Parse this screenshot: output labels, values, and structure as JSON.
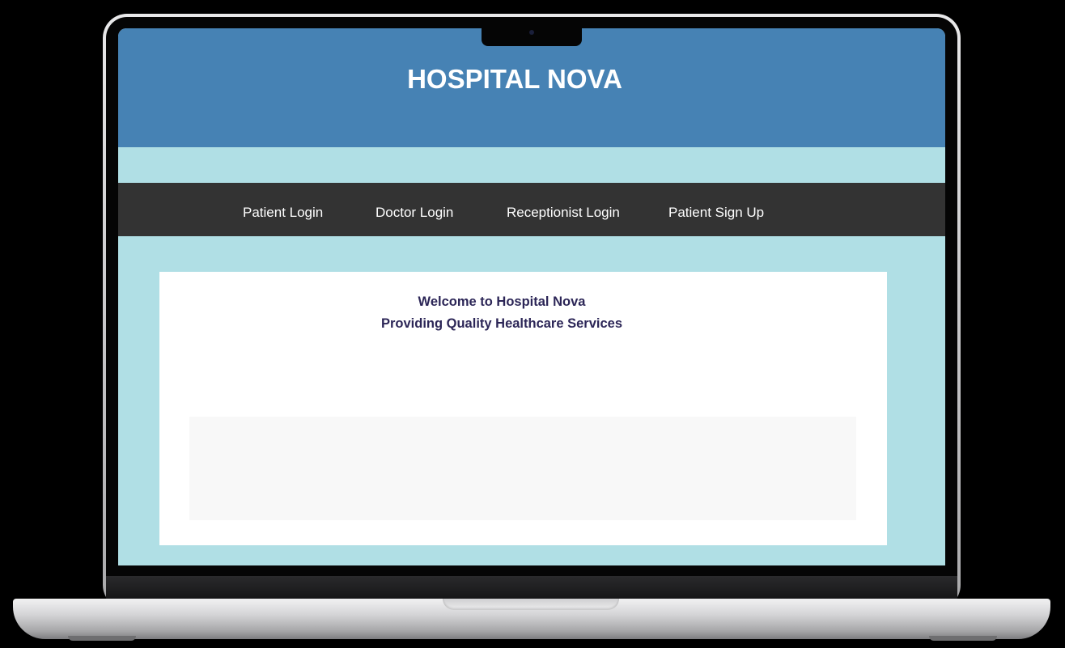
{
  "header": {
    "title": "HOSPITAL NOVA"
  },
  "nav": {
    "items": [
      {
        "label": "Patient Login"
      },
      {
        "label": "Doctor Login"
      },
      {
        "label": "Receptionist Login"
      },
      {
        "label": "Patient Sign Up"
      }
    ]
  },
  "main": {
    "welcome_title": "Welcome to Hospital Nova",
    "welcome_subtitle": "Providing Quality Healthcare Services"
  },
  "colors": {
    "header_bg": "#4682b4",
    "page_bg": "#b0dfe5",
    "nav_bg": "#333333",
    "card_bg": "#ffffff",
    "welcome_text": "#2c2657"
  }
}
